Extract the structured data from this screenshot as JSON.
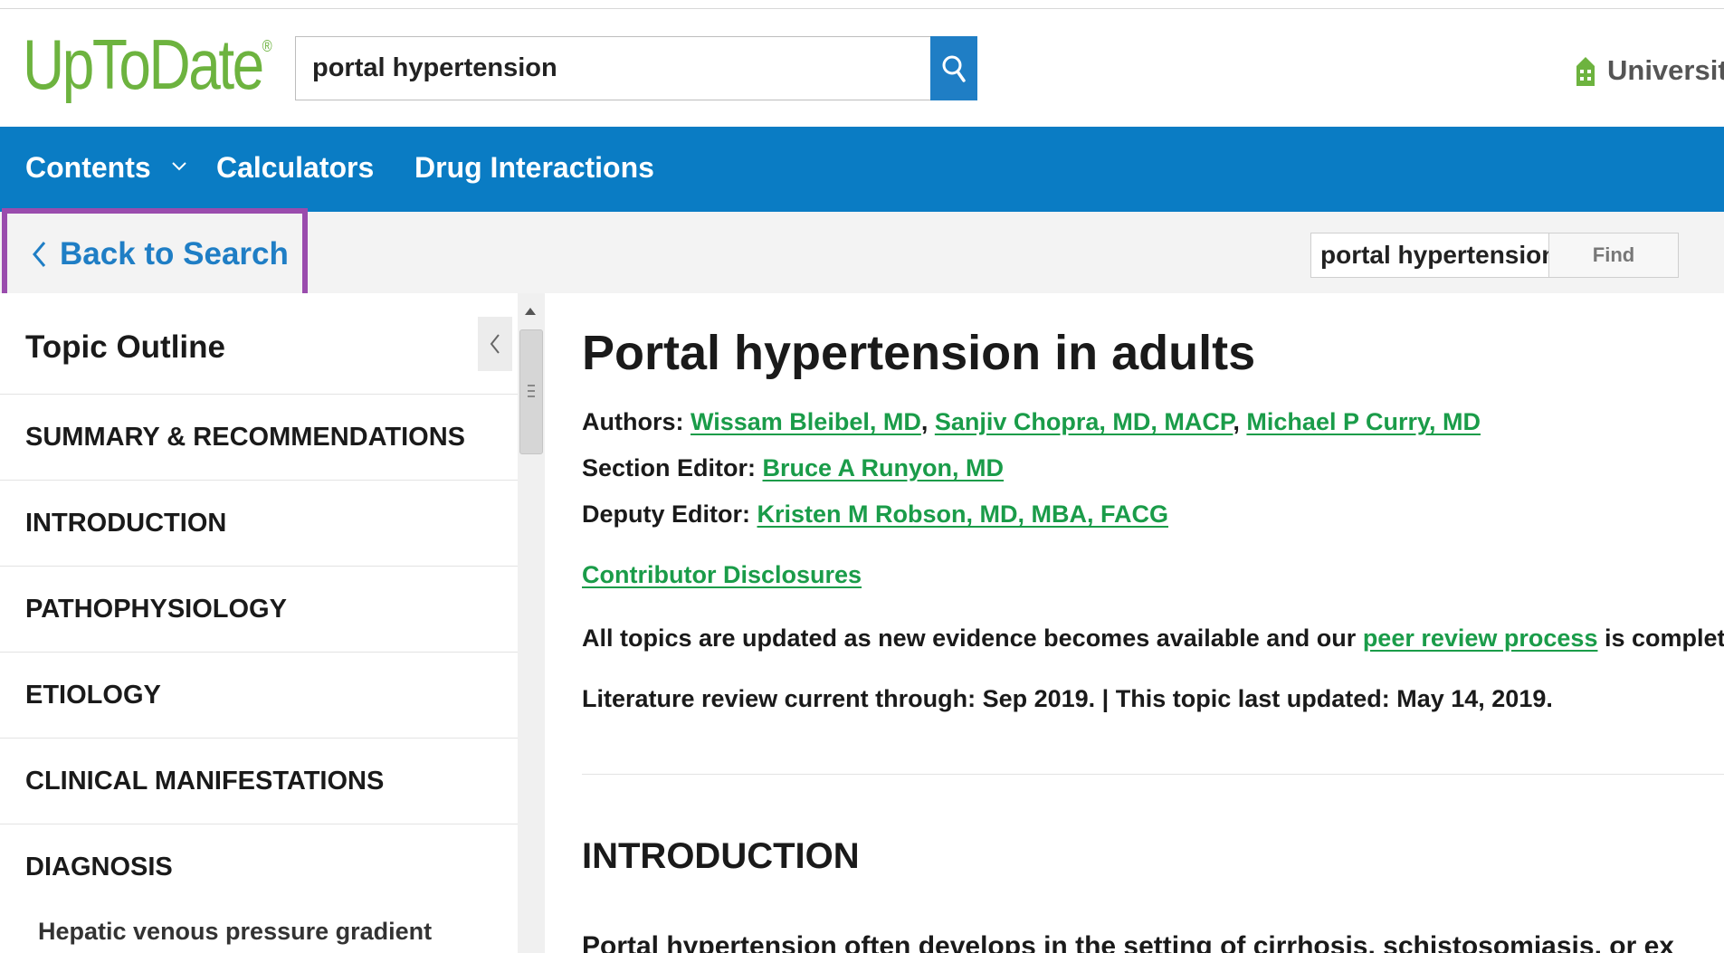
{
  "header": {
    "logo_text": "UpToDate",
    "logo_mark": "®",
    "search_value": "portal hypertension",
    "search_icon": "search-icon",
    "institution": "Universit",
    "institution_icon": "building-icon"
  },
  "nav": {
    "contents": "Contents",
    "calculators": "Calculators",
    "drug_interactions": "Drug Interactions"
  },
  "toolbar": {
    "back_label": "Back to Search",
    "find_value": "portal hypertension",
    "find_button": "Find"
  },
  "sidebar": {
    "title": "Topic Outline",
    "items": [
      {
        "label": "SUMMARY & RECOMMENDATIONS"
      },
      {
        "label": "INTRODUCTION"
      },
      {
        "label": "PATHOPHYSIOLOGY"
      },
      {
        "label": "ETIOLOGY"
      },
      {
        "label": "CLINICAL MANIFESTATIONS"
      },
      {
        "label": "DIAGNOSIS"
      }
    ],
    "sub_item": "Hepatic venous pressure gradient"
  },
  "article": {
    "title": "Portal hypertension in adults",
    "authors_label": "Authors:",
    "authors": [
      "Wissam Bleibel, MD",
      "Sanjiv Chopra, MD, MACP",
      "Michael P Curry, MD"
    ],
    "section_editor_label": "Section Editor:",
    "section_editor": "Bruce A Runyon, MD",
    "deputy_editor_label": "Deputy Editor:",
    "deputy_editor": "Kristen M Robson, MD, MBA, FACG",
    "disclosures": "Contributor Disclosures",
    "update_text_before": "All topics are updated as new evidence becomes available and our ",
    "peer_review_link": "peer review process",
    "update_text_after": " is complete.",
    "review_line": "Literature review current through: Sep 2019. | This topic last updated: May 14, 2019.",
    "section_title": "INTRODUCTION",
    "intro_text": "Portal hypertension often develops in the setting of cirrhosis, schistosomiasis, or ex"
  },
  "colors": {
    "brand_green": "#6db33f",
    "nav_blue": "#0a7cc4",
    "link_green": "#1a9c49",
    "highlight_purple": "#9a4cad"
  }
}
